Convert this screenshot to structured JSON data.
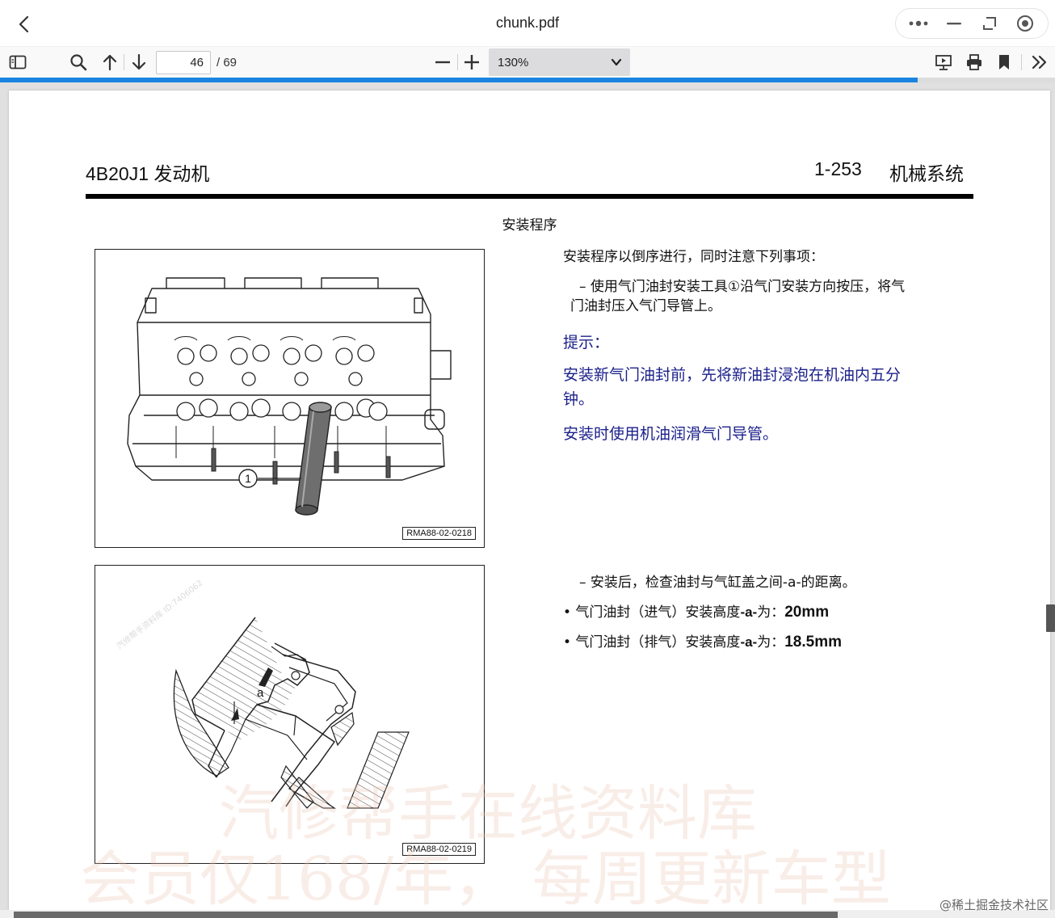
{
  "app": {
    "title": "chunk.pdf"
  },
  "toolbar": {
    "current_page": "46",
    "total_pages": "/ 69",
    "zoom_label": "130%",
    "progress_fraction": 0.87
  },
  "page": {
    "header_left": "4B20J1 发动机",
    "header_page_number": "1-253",
    "header_section": "机械系统",
    "section_title": "安装程序",
    "intro": "安装程序以倒序进行，同时注意下列事项：",
    "step1_line1": "– 使用气门油封安装工具①沿气门安装方向按压，将气",
    "step1_line2": "门油封压入气门导管上。",
    "note_title": "提示：",
    "note1_line1": "安装新气门油封前，先将新油封浸泡在机油内五分",
    "note1_line2": "钟。",
    "note2": "安装时使用机油润滑气门导管。",
    "step2": "– 安装后，检查油封与气缸盖之间-a-的距离。",
    "spec1_prefix": "• 气门油封（进气）安装高度",
    "spec1_var": "-a-",
    "spec1_mid": "为：",
    "spec1_value": "20mm",
    "spec2_prefix": "• 气门油封（排气）安装高度",
    "spec2_var": "-a-",
    "spec2_mid": "为：",
    "spec2_value": "18.5mm",
    "figure1_code": "RMA88-02-0218",
    "figure1_callout": "1",
    "figure2_code": "RMA88-02-0219",
    "figure2_label": "a",
    "watermark_line1": "汽修帮手在线资料库",
    "watermark_line2": "会员仅168/年， 每周更新车型",
    "watermark_small": "汽修帮手资料库 ID:7406062",
    "corner_credit": "@稀土掘金技术社区"
  }
}
